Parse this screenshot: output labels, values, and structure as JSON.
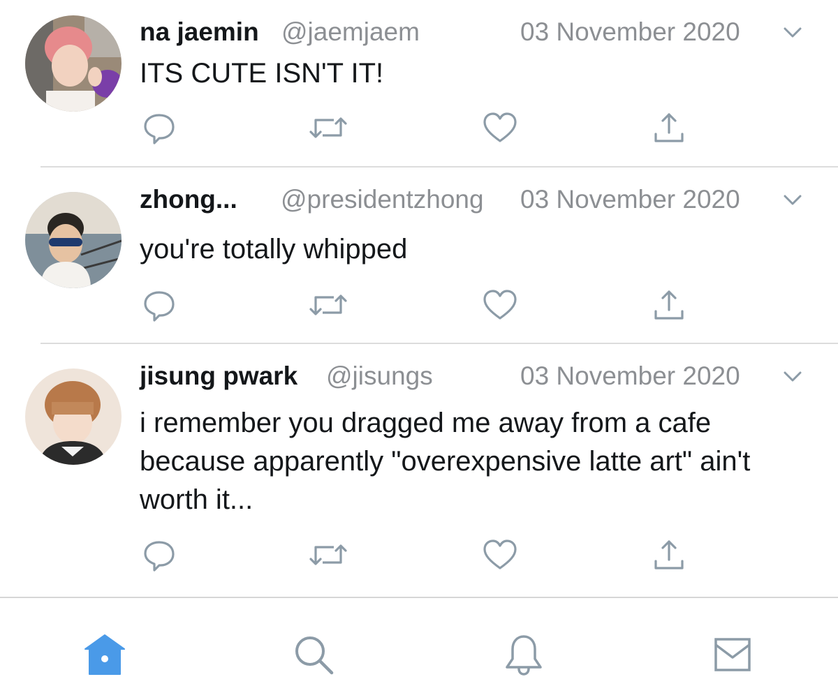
{
  "colors": {
    "accent": "#4a9ae8",
    "icon_gray": "#8c9ba7",
    "meta_gray": "#8c8f93",
    "divider": "#dcdcdc"
  },
  "tweets": [
    {
      "name": "na jaemin",
      "handle": "@jaemjaem",
      "date": "03 November 2020",
      "text": "ITS CUTE ISN'T IT!"
    },
    {
      "name": "zhong...",
      "handle": "@presidentzhong",
      "date": "03 November 2020",
      "text": "you're totally whipped"
    },
    {
      "name": "jisung pwark",
      "handle": "@jisungs",
      "date": "03 November 2020",
      "text": "i remember you dragged me away from a cafe because apparently \"overexpensive latte art\" ain't worth it..."
    }
  ],
  "action_icons": [
    "reply-icon",
    "retweet-icon",
    "like-icon",
    "share-icon"
  ],
  "tabbar": {
    "items": [
      {
        "icon": "home-icon",
        "active": true
      },
      {
        "icon": "search-icon",
        "active": false
      },
      {
        "icon": "notifications-icon",
        "active": false
      },
      {
        "icon": "messages-icon",
        "active": false
      }
    ]
  }
}
